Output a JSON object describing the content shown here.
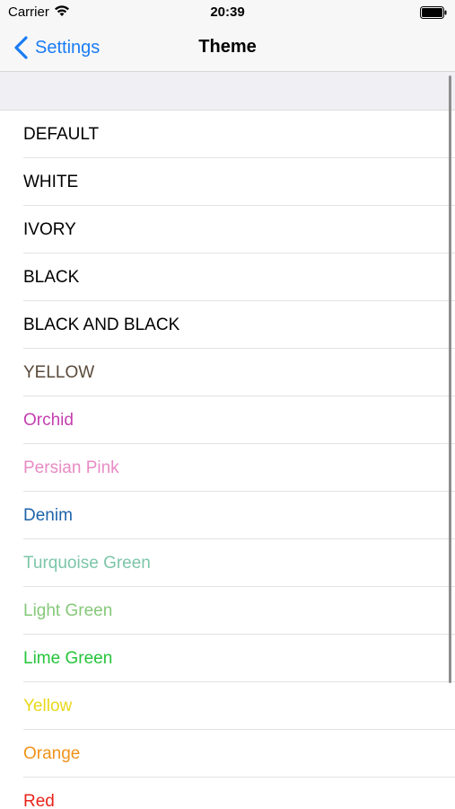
{
  "status_bar": {
    "carrier": "Carrier",
    "time": "20:39"
  },
  "nav": {
    "back_label": "Settings",
    "title": "Theme"
  },
  "colors": {
    "accent": "#1a7cf5"
  },
  "themes": [
    {
      "label": "DEFAULT",
      "color": "#000000"
    },
    {
      "label": "WHITE",
      "color": "#000000"
    },
    {
      "label": "IVORY",
      "color": "#000000"
    },
    {
      "label": "BLACK",
      "color": "#000000"
    },
    {
      "label": "BLACK AND BLACK",
      "color": "#000000"
    },
    {
      "label": "YELLOW",
      "color": "#5a4a3a"
    },
    {
      "label": "Orchid",
      "color": "#c43fb0"
    },
    {
      "label": "Persian Pink",
      "color": "#e88bc4"
    },
    {
      "label": "Denim",
      "color": "#1e63a8"
    },
    {
      "label": "Turquoise Green",
      "color": "#7cc6a8"
    },
    {
      "label": "Light Green",
      "color": "#86c97a"
    },
    {
      "label": "Lime Green",
      "color": "#25c43a"
    },
    {
      "label": "Yellow",
      "color": "#e8d81a"
    },
    {
      "label": "Orange",
      "color": "#f0921a"
    },
    {
      "label": "Red",
      "color": "#e8231a"
    }
  ]
}
